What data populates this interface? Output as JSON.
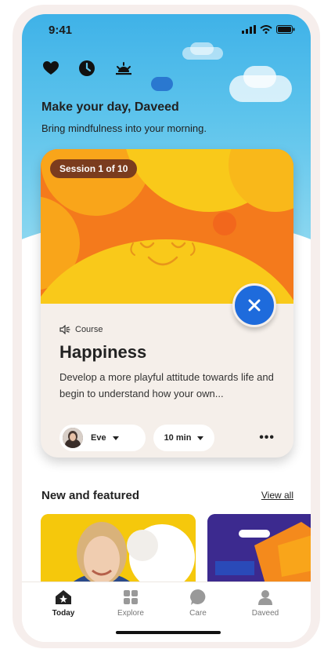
{
  "status_bar": {
    "time": "9:41"
  },
  "header": {
    "icons": [
      "heart-icon",
      "clock-icon",
      "sunrise-icon"
    ],
    "greeting": "Make your day, Daveed",
    "subtitle": "Bring mindfulness into your morning."
  },
  "session_card": {
    "badge": "Session 1 of 10",
    "type_label": "Course",
    "title": "Happiness",
    "description": "Develop a more playful attitude towards life and begin to understand how your own...",
    "narrator": "Eve",
    "duration": "10 min",
    "more_label": "•••",
    "colors": {
      "accent": "#1e6bdc",
      "hero": "#f47a1c",
      "sun": "#f9c91a"
    }
  },
  "featured": {
    "title": "New and featured",
    "view_all": "View all"
  },
  "tabbar": {
    "tabs": [
      {
        "label": "Today",
        "icon": "home-icon",
        "active": true
      },
      {
        "label": "Explore",
        "icon": "grid-icon",
        "active": false
      },
      {
        "label": "Care",
        "icon": "chat-bubble-icon",
        "active": false
      },
      {
        "label": "Daveed",
        "icon": "profile-icon",
        "active": false
      }
    ]
  }
}
